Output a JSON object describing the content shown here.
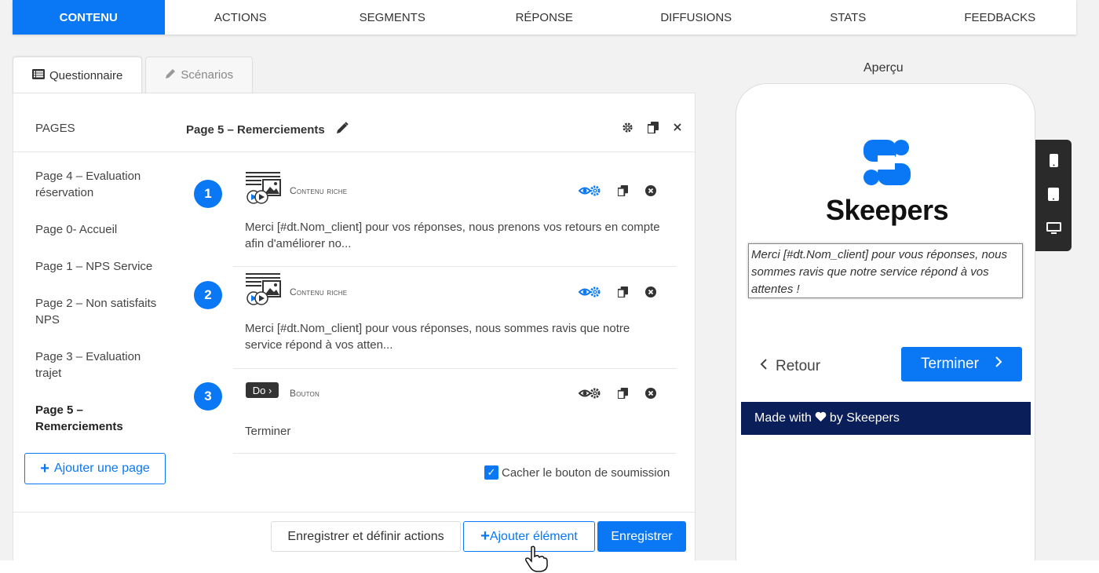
{
  "topnav": {
    "tabs": [
      "Contenu",
      "Actions",
      "Segments",
      "Réponse",
      "Diffusions",
      "Stats",
      "Feedbacks"
    ],
    "active_index": 0
  },
  "editor_tabs": {
    "questionnaire": "Questionnaire",
    "scenarios": "Scénarios"
  },
  "panel": {
    "pages_label": "PAGES",
    "current_page_title": "Page 5 – Remerciements",
    "pages": [
      "Page 4 – Evaluation réservation",
      "Page 0- Accueil",
      "Page 1 – NPS Service",
      "Page 2 – Non satisfaits NPS",
      "Page 3 – Evaluation trajet",
      "Page 5 – Remerciements"
    ],
    "active_page_index": 5,
    "add_page_label": "Ajouter une page",
    "elements": [
      {
        "number": "1",
        "type": "Contenu riche",
        "icon": "rich-content-icon",
        "text": "Merci [#dt.Nom_client] pour vos réponses, nous prenons vos retours en compte afin d'améliorer no..."
      },
      {
        "number": "2",
        "type": "Contenu riche",
        "icon": "rich-content-icon",
        "text": "Merci [#dt.Nom_client] pour vous réponses, nous sommes ravis que notre service répond à vos atten..."
      },
      {
        "number": "3",
        "type": "Bouton",
        "icon": "button-type-icon",
        "icon_label": "Do",
        "text": "Terminer"
      }
    ],
    "hide_submit_label": "Cacher le bouton de soumission",
    "hide_submit_checked": true,
    "buttons": {
      "save_actions": "Enregistrer et définir actions",
      "add_element": "Ajouter élément",
      "save": "Enregistrer"
    }
  },
  "preview": {
    "title": "Aperçu",
    "brand": "Skeepers",
    "text": "Merci [#dt.Nom_client] pour vous réponses, nous sommes ravis que notre service répond à vos attentes !",
    "back_label": "Retour",
    "finish_label": "Terminer",
    "made_with_prefix": "Made with",
    "made_with_suffix": "by Skeepers"
  },
  "colors": {
    "accent": "#0a78f5",
    "footer_bar": "#0a1f5a"
  }
}
